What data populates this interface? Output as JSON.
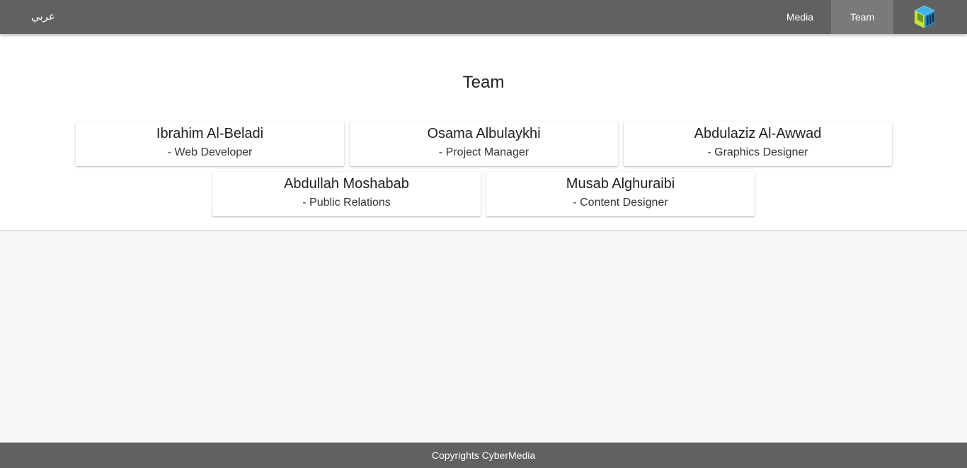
{
  "nav": {
    "language_link": "عربي",
    "items": [
      {
        "label": "Media",
        "active": false
      },
      {
        "label": "Team",
        "active": true
      }
    ]
  },
  "page": {
    "title": "Team"
  },
  "team": [
    {
      "name": "Ibrahim Al-Beladi",
      "role": "- Web Developer"
    },
    {
      "name": "Osama Albulaykhi",
      "role": "- Project Manager"
    },
    {
      "name": "Abdulaziz Al-Awwad",
      "role": "- Graphics Designer"
    },
    {
      "name": "Abdullah Moshabab",
      "role": "- Public Relations"
    },
    {
      "name": "Musab Alghuraibi",
      "role": "- Content Designer"
    }
  ],
  "footer": {
    "text": "Copyrights CyberMedia"
  },
  "colors": {
    "navbar": "#616161",
    "active_tab": "#7a7a7a",
    "footer": "#616161",
    "page_background": "#f8f8f8"
  },
  "icons": {
    "logo": "cybermedia-cube-logo-icon"
  }
}
